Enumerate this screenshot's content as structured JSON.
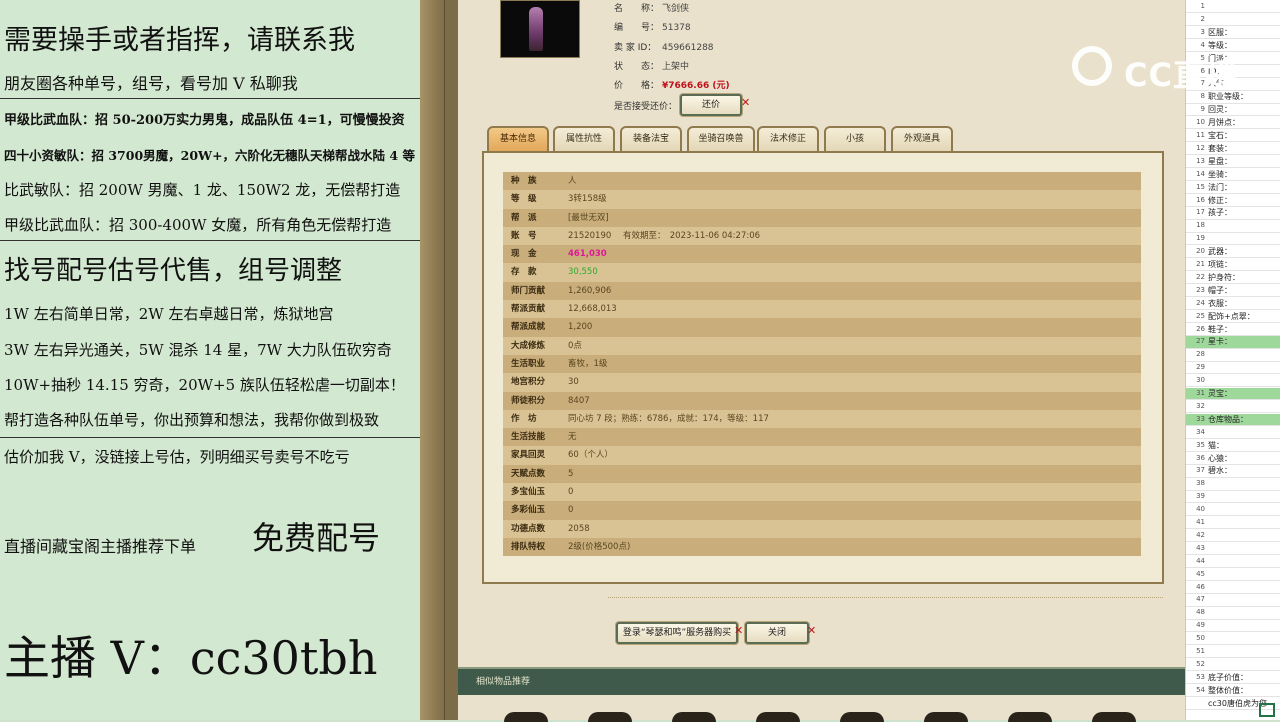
{
  "overlay": {
    "lines": [
      "需要操手或者指挥，请联系我",
      "朋友圈各种单号，组号，看号加 V 私聊我",
      "甲级比武血队：招 50-200万实力男鬼，成品队伍 4=1，可慢慢投资",
      "四十小资敏队：招 3700男魔，20W+，六阶化无穗队天梯帮战水陆 4 等 1",
      "比武敏队：招 200W 男魔、1 龙、150W2 龙，无偿帮打造",
      "甲级比武血队：招 300-400W 女魔，所有角色无偿帮打造",
      "找号配号估号代售，组号调整",
      "1W 左右简单日常，2W 左右卓越日常，炼狱地宫",
      "3W 左右异光通关，5W 混杀 14 星，7W 大力队伍砍穷奇",
      "10W+抽秒 14.15 穷奇，20W+5 族队伍轻松虐一切副本！",
      "帮打造各种队伍单号，你出预算和想法，我帮你做到极致",
      "估价加我 V，没链接上号估，列明细买号卖号不吃亏",
      "直播间藏宝阁主播推荐下单",
      "免费配号",
      "主播 V：cc30tbh"
    ]
  },
  "item": {
    "name_label": "名　　称：",
    "name": "飞剑侠",
    "id_label": "编　　号：",
    "id": "51378",
    "seller_label": "卖 家 ID：",
    "seller": "459661288",
    "status_label": "状　　态：",
    "status": "上架中",
    "price_label": "价　　格：",
    "price": "¥7666.66 (元)",
    "bargain_label": "是否接受还价：",
    "bargain_button": "还价"
  },
  "tabs": [
    "基本信息",
    "属性抗性",
    "装备法宝",
    "坐骑召唤兽",
    "法术修正",
    "小孩",
    "外观道具"
  ],
  "details": [
    {
      "label": "种　族",
      "value": "人"
    },
    {
      "label": "等　级",
      "value": "3转158级"
    },
    {
      "label": "帮　派",
      "value": "[最世无双]"
    },
    {
      "label": "账　号",
      "value": "21520190",
      "extra": "有效期至：　2023-11-06 04:27:06"
    },
    {
      "label": "现　金",
      "value": "461,030"
    },
    {
      "label": "存　款",
      "value": "30,550"
    },
    {
      "label": "师门贡献",
      "value": "1,260,906"
    },
    {
      "label": "帮派贡献",
      "value": "12,668,013"
    },
    {
      "label": "帮派成就",
      "value": "1,200"
    },
    {
      "label": "大成修炼",
      "value": "0点"
    },
    {
      "label": "生活职业",
      "value": "畜牧，1级"
    },
    {
      "label": "地宫积分",
      "value": "30"
    },
    {
      "label": "师徒积分",
      "value": "8407"
    },
    {
      "label": "作　坊",
      "value": "同心坊 7 段；熟练：6786，成就：174，等级：117"
    },
    {
      "label": "生活技能",
      "value": "无"
    },
    {
      "label": "家具回灵",
      "value": "60（个人）"
    },
    {
      "label": "天赋点数",
      "value": "5"
    },
    {
      "label": "多宝仙玉",
      "value": "0"
    },
    {
      "label": "多彩仙玉",
      "value": "0"
    },
    {
      "label": "功德点数",
      "value": "2058"
    },
    {
      "label": "排队特权",
      "value": "2级(价格500点)"
    }
  ],
  "colors": {
    "cash": "#e0179a",
    "deposit": "#2fa82f",
    "price": "#c0111b"
  },
  "actions": {
    "login_button": "登录“琴瑟和鸣”服务器购买",
    "close_button": "关闭"
  },
  "similar_title": "相似物品推荐",
  "watermark": "CC直播",
  "sheet": {
    "rows": [
      {
        "n": "1",
        "t": ""
      },
      {
        "n": "2",
        "t": ""
      },
      {
        "n": "3",
        "t": "区服："
      },
      {
        "n": "4",
        "t": "等级："
      },
      {
        "n": "5",
        "t": "门派："
      },
      {
        "n": "6",
        "t": "ID："
      },
      {
        "n": "7",
        "t": "人气："
      },
      {
        "n": "8",
        "t": "职业等级："
      },
      {
        "n": "9",
        "t": "回灵："
      },
      {
        "n": "10",
        "t": "月饼点："
      },
      {
        "n": "11",
        "t": "宝石："
      },
      {
        "n": "12",
        "t": "套装："
      },
      {
        "n": "13",
        "t": "星盘："
      },
      {
        "n": "14",
        "t": "坐骑："
      },
      {
        "n": "15",
        "t": "法门："
      },
      {
        "n": "16",
        "t": "修正："
      },
      {
        "n": "17",
        "t": "孩子："
      },
      {
        "n": "18",
        "t": ""
      },
      {
        "n": "19",
        "t": ""
      },
      {
        "n": "20",
        "t": "武器："
      },
      {
        "n": "21",
        "t": "项链："
      },
      {
        "n": "22",
        "t": "护身符："
      },
      {
        "n": "23",
        "t": "帽子："
      },
      {
        "n": "24",
        "t": "衣服："
      },
      {
        "n": "25",
        "t": "配饰+点翠："
      },
      {
        "n": "26",
        "t": "鞋子："
      },
      {
        "n": "27",
        "t": "星卡：",
        "green": true
      },
      {
        "n": "28",
        "t": ""
      },
      {
        "n": "29",
        "t": ""
      },
      {
        "n": "30",
        "t": ""
      },
      {
        "n": "31",
        "t": "灵宝：",
        "green": true
      },
      {
        "n": "32",
        "t": ""
      },
      {
        "n": "33",
        "t": "仓库物品：",
        "green": true
      },
      {
        "n": "34",
        "t": ""
      },
      {
        "n": "35",
        "t": "猫："
      },
      {
        "n": "36",
        "t": "心猿："
      },
      {
        "n": "37",
        "t": "碧水："
      },
      {
        "n": "38",
        "t": ""
      },
      {
        "n": "39",
        "t": ""
      },
      {
        "n": "40",
        "t": ""
      },
      {
        "n": "41",
        "t": ""
      },
      {
        "n": "42",
        "t": ""
      },
      {
        "n": "43",
        "t": ""
      },
      {
        "n": "44",
        "t": ""
      },
      {
        "n": "45",
        "t": ""
      },
      {
        "n": "46",
        "t": ""
      },
      {
        "n": "47",
        "t": ""
      },
      {
        "n": "48",
        "t": ""
      },
      {
        "n": "49",
        "t": ""
      },
      {
        "n": "50",
        "t": ""
      },
      {
        "n": "51",
        "t": ""
      },
      {
        "n": "52",
        "t": ""
      },
      {
        "n": "53",
        "t": "底子价值："
      },
      {
        "n": "54",
        "t": "整体价值："
      },
      {
        "n": "",
        "t": "cc30唐伯虎为您"
      }
    ]
  }
}
